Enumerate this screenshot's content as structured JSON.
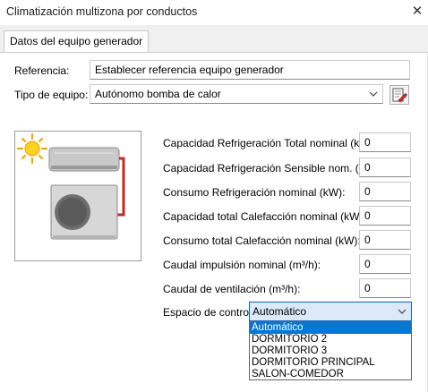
{
  "window": {
    "title": "Climatización multizona por conductos",
    "close_glyph": "✕"
  },
  "tabs": [
    {
      "label": "Datos del equipo generador",
      "active": true
    }
  ],
  "form": {
    "referencia_label": "Referencia:",
    "referencia_value": "Establecer referencia equipo generador",
    "tipo_label": "Tipo de equipo:",
    "tipo_value": "Autónomo bomba de calor",
    "edit_icon": "edit-equipment-icon"
  },
  "fields": [
    {
      "label": "Capacidad Refrigeración Total nominal (kW):",
      "value": "0"
    },
    {
      "label": "Capacidad Refrigeración Sensible nom. (kW):",
      "value": "0"
    },
    {
      "label": "Consumo Refrigeración nominal (kW):",
      "value": "0"
    },
    {
      "label": "Capacidad total Calefacción nominal (kW):",
      "value": "0"
    },
    {
      "label": "Consumo total Calefacción nominal (kW):",
      "value": "0"
    },
    {
      "label": "Caudal impulsión nominal (m³/h):",
      "value": "0"
    },
    {
      "label": "Caudal de ventilación (m³/h):",
      "value": "0"
    }
  ],
  "control": {
    "label": "Espacio de control:",
    "selected": "Automático",
    "options": [
      "Automático",
      "DORMITORIO 2",
      "DORMITORIO 3",
      "DORMITORIO PRINCIPAL",
      "SALON-COMEDOR"
    ]
  },
  "colors": {
    "accent": "#0078d7",
    "focus_border": "#0a64c8",
    "tab_strip": "#f0f0f0"
  }
}
